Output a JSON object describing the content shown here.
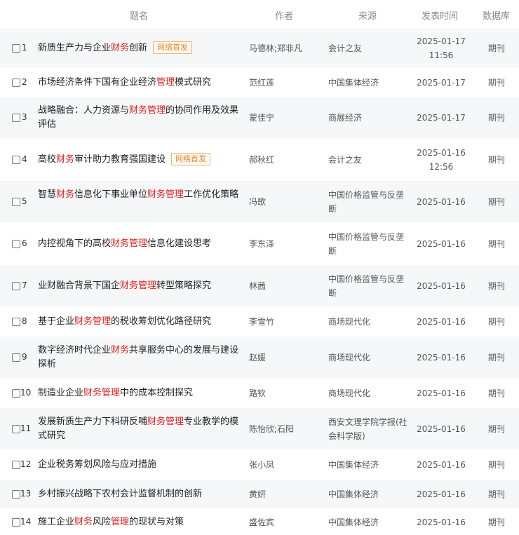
{
  "header": {
    "title": "题名",
    "author": "作者",
    "source": "来源",
    "date": "发表时间",
    "db": "数据库"
  },
  "rows": [
    {
      "num": "1",
      "title": [
        [
          "新质生产力与企业",
          0
        ],
        [
          "财务",
          1
        ],
        [
          "创新",
          0
        ]
      ],
      "badge": "网络首发",
      "author": "马德林;郑非凡",
      "source": "会计之友",
      "date": "2025-01-17\n11:56",
      "db": "期刊"
    },
    {
      "num": "2",
      "title": [
        [
          "市场经济条件下国有企业经济",
          0
        ],
        [
          "管理",
          1
        ],
        [
          "模式研究",
          0
        ]
      ],
      "badge": "",
      "author": "范红莲",
      "source": "中国集体经济",
      "date": "2025-01-17",
      "db": "期刊"
    },
    {
      "num": "3",
      "title": [
        [
          "战略融合：人力资源与",
          0
        ],
        [
          "财务管理",
          1
        ],
        [
          "的协同作用及效果评估",
          0
        ]
      ],
      "badge": "",
      "author": "蒙佳宁",
      "source": "商展经济",
      "date": "2025-01-17",
      "db": "期刊"
    },
    {
      "num": "4",
      "title": [
        [
          "高校",
          0
        ],
        [
          "财务",
          1
        ],
        [
          "审计助力教育强国建设",
          0
        ]
      ],
      "badge": "网络首发",
      "author": "郝秋红",
      "source": "会计之友",
      "date": "2025-01-16\n12:56",
      "db": "期刊"
    },
    {
      "num": "5",
      "title": [
        [
          "智慧",
          0
        ],
        [
          "财务",
          1
        ],
        [
          "信息化下事业单位",
          0
        ],
        [
          "财务管理",
          1
        ],
        [
          "工作优化策略",
          0
        ]
      ],
      "badge": "",
      "author": "冯歌",
      "source": "中国价格监管与反垄断",
      "date": "2025-01-16",
      "db": "期刊"
    },
    {
      "num": "6",
      "title": [
        [
          "内控视角下的高校",
          0
        ],
        [
          "财务管理",
          1
        ],
        [
          "信息化建设思考",
          0
        ]
      ],
      "badge": "",
      "author": "李东泽",
      "source": "中国价格监管与反垄断",
      "date": "2025-01-16",
      "db": "期刊"
    },
    {
      "num": "7",
      "title": [
        [
          "业财融合背景下国企",
          0
        ],
        [
          "财务管理",
          1
        ],
        [
          "转型策略探究",
          0
        ]
      ],
      "badge": "",
      "author": "林茜",
      "source": "中国价格监管与反垄断",
      "date": "2025-01-16",
      "db": "期刊"
    },
    {
      "num": "8",
      "title": [
        [
          "基于企业",
          0
        ],
        [
          "财务管理",
          1
        ],
        [
          "的税收筹划优化路径研究",
          0
        ]
      ],
      "badge": "",
      "author": "李雪竹",
      "source": "商场现代化",
      "date": "2025-01-16",
      "db": "期刊"
    },
    {
      "num": "9",
      "title": [
        [
          "数字经济时代企业",
          0
        ],
        [
          "财务",
          1
        ],
        [
          "共享服务中心的发展与建设探析",
          0
        ]
      ],
      "badge": "",
      "author": "赵媛",
      "source": "商场现代化",
      "date": "2025-01-16",
      "db": "期刊"
    },
    {
      "num": "10",
      "title": [
        [
          "制造业企业",
          0
        ],
        [
          "财务管理",
          1
        ],
        [
          "中的成本控制探究",
          0
        ]
      ],
      "badge": "",
      "author": "路钦",
      "source": "商场现代化",
      "date": "2025-01-16",
      "db": "期刊"
    },
    {
      "num": "11",
      "title": [
        [
          "发展新质生产力下科研反哺",
          0
        ],
        [
          "财务管理",
          1
        ],
        [
          "专业教学的模式研究",
          0
        ]
      ],
      "badge": "",
      "author": "陈怡欣;石阳",
      "source": "西安文理学院学报(社会科学版)",
      "date": "2025-01-16",
      "db": "期刊"
    },
    {
      "num": "12",
      "title": [
        [
          "企业税务筹划风险与应对措施",
          0
        ]
      ],
      "badge": "",
      "author": "张小凤",
      "source": "中国集体经济",
      "date": "2025-01-16",
      "db": "期刊"
    },
    {
      "num": "13",
      "title": [
        [
          "乡村振兴战略下农村会计监督机制的创新",
          0
        ]
      ],
      "badge": "",
      "author": "黄妍",
      "source": "中国集体经济",
      "date": "2025-01-16",
      "db": "期刊"
    },
    {
      "num": "14",
      "title": [
        [
          "施工企业",
          0
        ],
        [
          "财务",
          1
        ],
        [
          "风险",
          0
        ],
        [
          "管理",
          1
        ],
        [
          "的现状与对策",
          0
        ]
      ],
      "badge": "",
      "author": "盛佐宾",
      "source": "中国集体经济",
      "date": "2025-01-16",
      "db": "期刊"
    }
  ],
  "colors": {
    "highlight": "#e02020",
    "badge": "#e08a2e",
    "row_alt": "#f6f7f9"
  }
}
